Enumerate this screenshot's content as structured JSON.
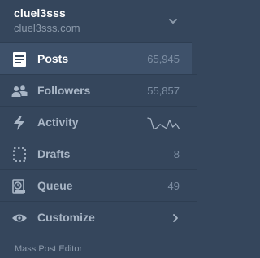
{
  "account": {
    "name": "cluel3sss",
    "url": "cluel3sss.com"
  },
  "menu": [
    {
      "id": "posts",
      "label": "Posts",
      "count": "65,945",
      "icon": "posts-icon",
      "active": true
    },
    {
      "id": "followers",
      "label": "Followers",
      "count": "55,857",
      "icon": "followers-icon"
    },
    {
      "id": "activity",
      "label": "Activity",
      "icon": "lightning-icon",
      "sparkline": [
        0.15,
        0.2,
        0.95,
        0.85,
        0.6,
        0.75,
        0.9,
        0.3,
        0.8,
        0.55,
        0.92
      ]
    },
    {
      "id": "drafts",
      "label": "Drafts",
      "count": "8",
      "icon": "drafts-icon"
    },
    {
      "id": "queue",
      "label": "Queue",
      "count": "49",
      "icon": "queue-icon"
    },
    {
      "id": "customize",
      "label": "Customize",
      "icon": "eye-icon"
    }
  ],
  "footer": {
    "mass_post_editor": "Mass Post Editor"
  },
  "colors": {
    "background": "#35465c",
    "active_row": "#3e516a",
    "icon": "#a9b6c6",
    "muted_text": "#7d8ea3"
  }
}
